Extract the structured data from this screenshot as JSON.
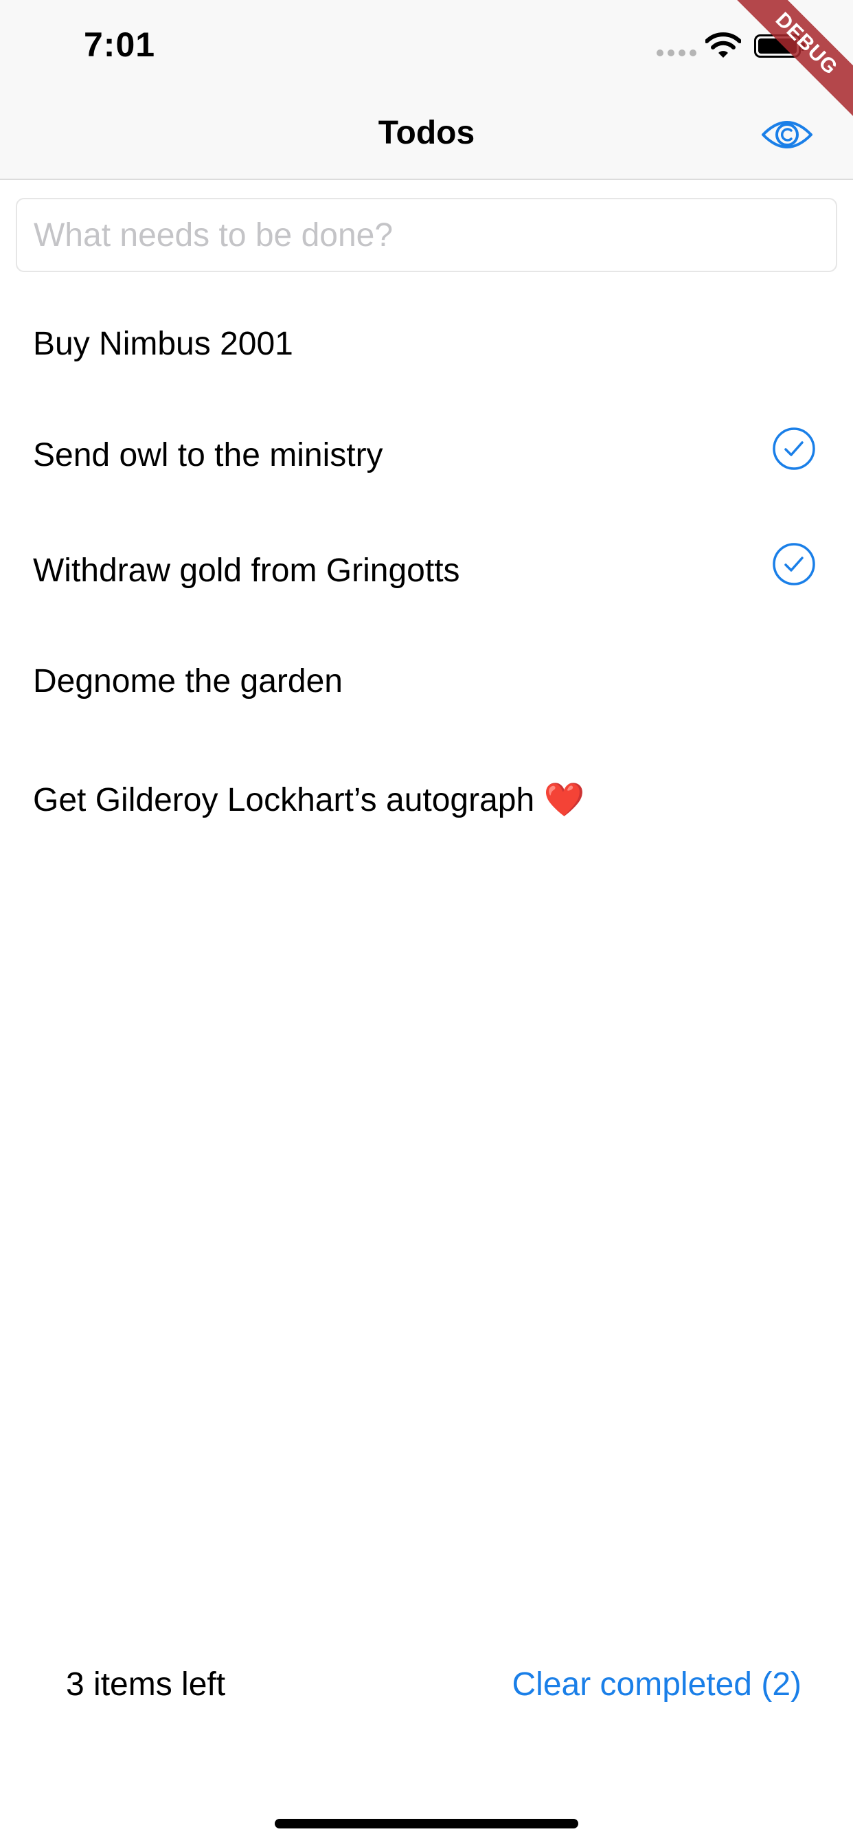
{
  "status_bar": {
    "time": "7:01"
  },
  "nav": {
    "title": "Todos",
    "filter_icon": "eye-icon"
  },
  "debug_banner": "DEBUG",
  "new_todo": {
    "placeholder": "What needs to be done?",
    "value": ""
  },
  "todos": [
    {
      "label": "Buy Nimbus 2001",
      "completed": false
    },
    {
      "label": "Send owl to the ministry",
      "completed": true
    },
    {
      "label": "Withdraw gold from Gringotts",
      "completed": true
    },
    {
      "label": "Degnome the garden",
      "completed": false
    },
    {
      "label": "Get Gilderoy Lockhart’s autograph ❤️",
      "completed": false
    }
  ],
  "footer": {
    "items_left": "3 items left",
    "clear_completed": "Clear completed (2)"
  },
  "colors": {
    "accent": "#1a7fe8",
    "placeholder": "#c4c4c7",
    "bar_bg": "#f8f8f8"
  }
}
